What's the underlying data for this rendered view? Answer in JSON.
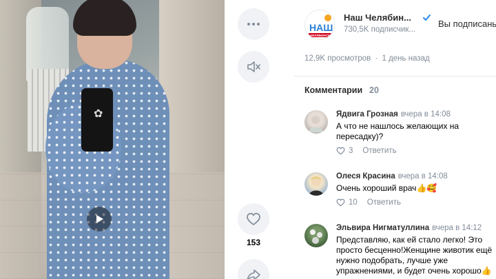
{
  "video": {
    "play_icon": "play-icon"
  },
  "actions": {
    "more_icon": "more-dots-icon",
    "mute_icon": "volume-muted-icon",
    "like_icon": "heart-icon",
    "like_count": "153",
    "share_icon": "share-icon"
  },
  "group": {
    "name": "Наш Челябин...",
    "subscribers": "730,5K подписчик...",
    "subscribed_label": "Вы подписаны",
    "logo_text_top": "НАШ",
    "logo_text_bottom": "ЧЕЛЯБИНСК",
    "verified_icon": "verified-check-icon"
  },
  "stats": {
    "views": "12,9K просмотров",
    "separator": "·",
    "posted": "1 день назад"
  },
  "comments": {
    "title": "Комментарии",
    "count": "20",
    "items": [
      {
        "author": "Ядвига Грозная",
        "time": "вчера в 14:08",
        "text": "А что не нашлось желающих на пересадку)?",
        "likes": "3",
        "reply": "Ответить"
      },
      {
        "author": "Олеся Красина",
        "time": "вчера в 14:08",
        "text": "Очень хороший врач👍🥰",
        "likes": "10",
        "reply": "Ответить"
      },
      {
        "author": "Эльвира Нигматуллина",
        "time": "вчера в 14:12",
        "text": "Представляю, как ей стало легко! Это просто бесценно!Женщине животик ещё нужно подобрать, лучше уже упражнениями, и будет очень хорошо👍",
        "likes": "",
        "reply": ""
      }
    ]
  },
  "colors": {
    "accent": "#2688eb",
    "secondary_text": "#818c99",
    "button_bg": "#f0f2f5",
    "dress": "#6e8fb8"
  }
}
